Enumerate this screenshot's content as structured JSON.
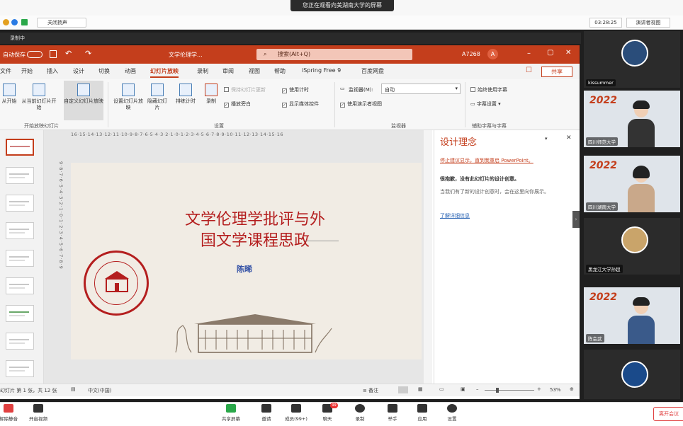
{
  "meeting": {
    "banner": "您正在观看向美湖南大学的屏幕",
    "recording": "录制中",
    "speaker_label": "关闭扬声",
    "timer": "03:28:25",
    "view_label": "演讲者视图"
  },
  "ppt": {
    "autosave": "自动保存",
    "doc_title": "文学伦理学...",
    "search_placeholder": "搜索(Alt+Q)",
    "user_code": "A7268",
    "user_initial": "A",
    "menu": [
      "文件",
      "开始",
      "插入",
      "设计",
      "切换",
      "动画",
      "幻灯片放映",
      "录制",
      "审阅",
      "视图",
      "帮助",
      "iSpring Free 9",
      "百度网盘"
    ],
    "menu_active": "幻灯片放映",
    "share": "共享",
    "ribbon": {
      "from_start": "从开始",
      "from_current": "从当前幻灯片开始",
      "custom": "自定义幻灯片放映",
      "group1": "开始放映幻灯片",
      "setup": "设置幻灯片放映",
      "hide": "隐藏幻灯片",
      "rehearse": "排练计时",
      "record": "录制",
      "chk_play_narr": "播放旁白",
      "chk_use_timing": "使用计时",
      "chk_show_media": "显示媒体控件",
      "chk_update": "保持幻灯片更新",
      "group2": "设置",
      "monitor_label": "监视器(M):",
      "monitor_value": "自动",
      "chk_presenter": "使用演示者视图",
      "group3": "监视器",
      "chk_subtitle": "始终使用字幕",
      "subtitle_settings": "字幕设置",
      "group4": "辅助字幕与字幕"
    },
    "hruler": "16·15·14·13·12·11·10·9·8·7·6·5·4·3·2·1·0·1·2·3·4·5·6·7·8·9·10·11·12·13·14·15·16",
    "vruler": "9·8·7·6·5·4·3·2·1·0·1·2·3·4·5·6·7·8·9",
    "slide": {
      "title_line1": "文学伦理学批评与外",
      "title_line2": "国文学课程思政",
      "author": "陈晞"
    },
    "design": {
      "title": "设计理念",
      "link1": "停止建议显示，直到我重启 PowerPoint。",
      "heading": "很抱歉，没有此幻灯片的设计创意。",
      "body": "当我们有了新的设计创意时，会在这里向你展示。",
      "link2": "了解详细信息"
    },
    "status": {
      "slide_info": "幻灯片 第 1 张，共 12 张",
      "language": "中文(中国)",
      "notes": "备注",
      "zoom": "53%"
    }
  },
  "participants": [
    {
      "name": "kissummer",
      "type": "avatar",
      "color": "#2a4d7a"
    },
    {
      "name": "四川师范大学",
      "type": "video"
    },
    {
      "name": "四川湖南大学",
      "type": "video"
    },
    {
      "name": "黑龙江大学孙超",
      "type": "avatar",
      "color": "#c9a46a"
    },
    {
      "name": "陈会武",
      "type": "video"
    },
    {
      "name": "",
      "type": "avatar",
      "color": "#1a4a8a"
    }
  ],
  "toolbar": {
    "mute": "解除静音",
    "video": "开启视频",
    "share": "共享屏幕",
    "invite": "邀请",
    "members": "成员(99+)",
    "chat": "聊天",
    "chat_badge": "99",
    "record": "录制",
    "raise": "举手",
    "apps": "应用",
    "settings": "设置",
    "leave": "离开会议"
  }
}
